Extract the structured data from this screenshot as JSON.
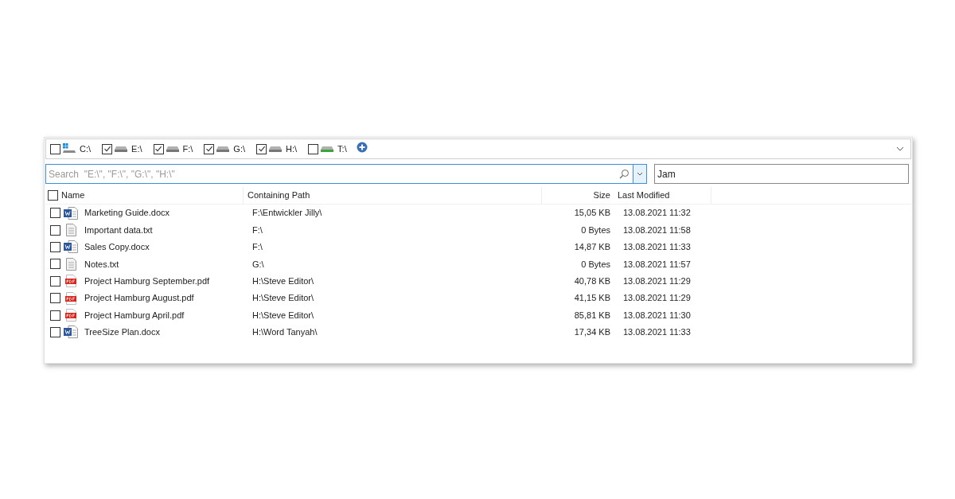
{
  "drives": [
    {
      "label": "C:\\",
      "kind": "system",
      "checked": false
    },
    {
      "label": "E:\\",
      "kind": "disk",
      "checked": true
    },
    {
      "label": "F:\\",
      "kind": "disk",
      "checked": true
    },
    {
      "label": "G:\\",
      "kind": "disk",
      "checked": true
    },
    {
      "label": "H:\\",
      "kind": "disk",
      "checked": true
    },
    {
      "label": "T:\\",
      "kind": "network",
      "checked": false
    }
  ],
  "search": {
    "placeholder": "Search  \"E:\\\", \"F:\\\", \"G:\\\", \"H:\\\""
  },
  "filter": {
    "value": "Jam"
  },
  "table": {
    "select_all": {
      "checked": false
    },
    "columns": [
      "Name",
      "Containing Path",
      "Size",
      "Last Modified"
    ],
    "rows": [
      {
        "kind": "word",
        "checked": false,
        "name": "Marketing Guide.docx",
        "path": "F:\\Entwickler Jilly\\",
        "size": "15,05 KB",
        "modified": "13.08.2021 11:32"
      },
      {
        "kind": "text",
        "checked": false,
        "name": "Important data.txt",
        "path": "F:\\",
        "size": "0 Bytes",
        "modified": "13.08.2021 11:58"
      },
      {
        "kind": "word",
        "checked": false,
        "name": "Sales Copy.docx",
        "path": "F:\\",
        "size": "14,87 KB",
        "modified": "13.08.2021 11:33"
      },
      {
        "kind": "text",
        "checked": false,
        "name": "Notes.txt",
        "path": "G:\\",
        "size": "0 Bytes",
        "modified": "13.08.2021 11:57"
      },
      {
        "kind": "pdf",
        "checked": false,
        "name": "Project Hamburg September.pdf",
        "path": "H:\\Steve Editor\\",
        "size": "40,78 KB",
        "modified": "13.08.2021 11:29"
      },
      {
        "kind": "pdf",
        "checked": false,
        "name": "Project Hamburg August.pdf",
        "path": "H:\\Steve Editor\\",
        "size": "41,15 KB",
        "modified": "13.08.2021 11:29"
      },
      {
        "kind": "pdf",
        "checked": false,
        "name": "Project Hamburg April.pdf",
        "path": "H:\\Steve Editor\\",
        "size": "85,81 KB",
        "modified": "13.08.2021 11:30"
      },
      {
        "kind": "word",
        "checked": false,
        "name": "TreeSize Plan.docx",
        "path": "H:\\Word Tanyah\\",
        "size": "17,34 KB",
        "modified": "13.08.2021 11:33"
      }
    ]
  }
}
